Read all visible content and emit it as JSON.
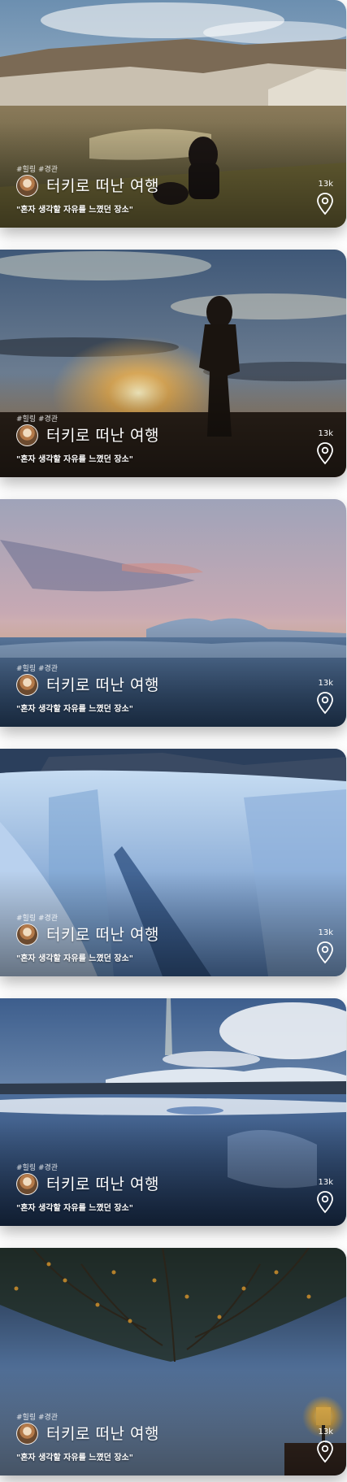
{
  "feed": {
    "cards": [
      {
        "tags": "#힐링 #경관",
        "title": "터키로 떠난 여행",
        "subtitle": "\"혼자 생각할 자유를 느꼈던 장소\"",
        "count": "13k",
        "scene": "cappadocia-valley-with-woman"
      },
      {
        "tags": "#힐링 #경관",
        "title": "터키로 떠난 여행",
        "subtitle": "\"혼자 생각할 자유를 느꼈던 장소\"",
        "count": "13k",
        "scene": "sunset-silhouette-woman"
      },
      {
        "tags": "#힐링 #경관",
        "title": "터키로 떠난 여행",
        "subtitle": "\"혼자 생각할 자유를 느꼈던 장소\"",
        "count": "13k",
        "scene": "snowy-plain-pink-sky"
      },
      {
        "tags": "#힐링 #경관",
        "title": "터키로 떠난 여행",
        "subtitle": "\"혼자 생각할 자유를 느꼈던 장소\"",
        "count": "13k",
        "scene": "glacier-ice"
      },
      {
        "tags": "#힐링 #경관",
        "title": "터키로 떠난 여행",
        "subtitle": "\"혼자 생각할 자유를 느꼈던 장소\"",
        "count": "13k",
        "scene": "glacier-lagoon"
      },
      {
        "tags": "#힐링 #경관",
        "title": "터키로 떠난 여행",
        "subtitle": "\"혼자 생각할 자유를 느꼈던 장소\"",
        "count": "13k",
        "scene": "tree-branches-street-lamp"
      }
    ],
    "icons": {
      "location": "location-pin-icon",
      "avatar": "user-avatar"
    }
  }
}
